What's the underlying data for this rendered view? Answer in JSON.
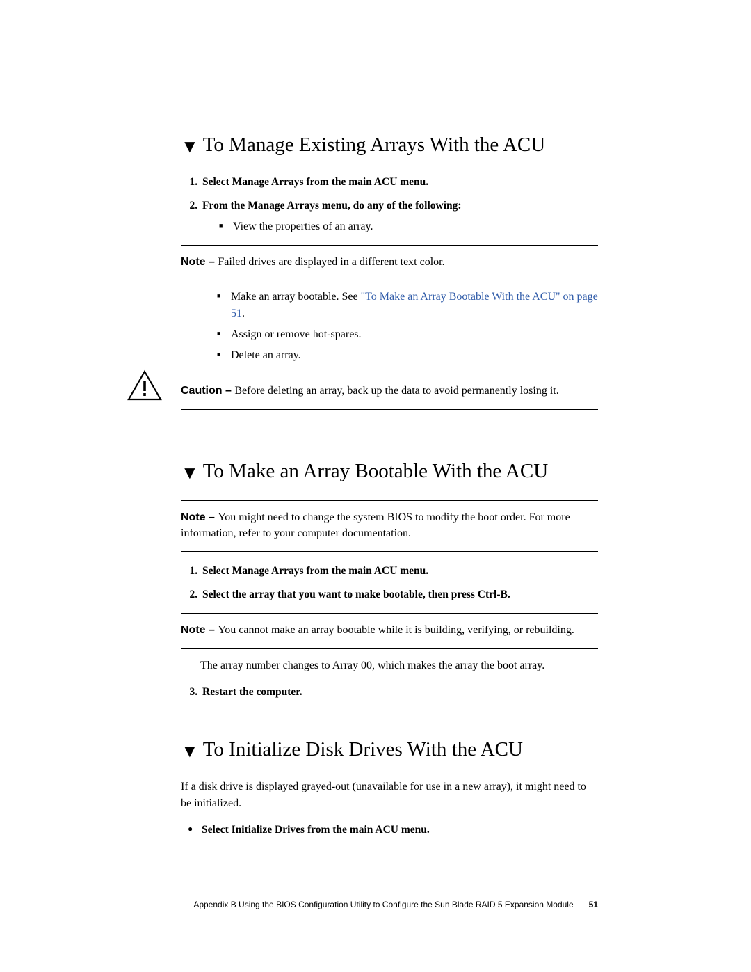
{
  "sections": {
    "s1": {
      "title": "To Manage Existing Arrays With the ACU",
      "step1": "Select Manage Arrays from the main ACU menu.",
      "step2": "From the Manage Arrays menu, do any of the following:",
      "step2_b1": "View the properties of an array.",
      "note1": "Failed drives are displayed in a different text color.",
      "step2_b2_pre": "Make an array bootable. See ",
      "step2_b2_link": "\"To Make an Array Bootable With the ACU\" on page 51",
      "step2_b2_post": ".",
      "step2_b3": "Assign or remove hot-spares.",
      "step2_b4": "Delete an array.",
      "caution": "Before deleting an array, back up the data to avoid permanently losing it."
    },
    "s2": {
      "title": "To Make an Array Bootable With the ACU",
      "note1": "You might need to change the system BIOS to modify the boot order. For more information, refer to your computer documentation.",
      "step1": "Select Manage Arrays from the main ACU menu.",
      "step2": "Select the array that you want to make bootable, then press Ctrl-B.",
      "note2": "You cannot make an array bootable while it is building, verifying, or rebuilding.",
      "result": "The array number changes to Array 00, which makes the array the boot array.",
      "step3": "Restart the computer."
    },
    "s3": {
      "title": "To Initialize Disk Drives With the ACU",
      "intro": "If a disk drive is displayed grayed-out (unavailable for use in a new array), it might need to be initialized.",
      "b1": "Select Initialize Drives from the main ACU menu."
    }
  },
  "labels": {
    "note": "Note – ",
    "caution": "Caution – "
  },
  "footer": {
    "text": "Appendix B     Using the BIOS Configuration Utility to Configure the Sun Blade RAID 5 Expansion Module",
    "page": "51"
  }
}
